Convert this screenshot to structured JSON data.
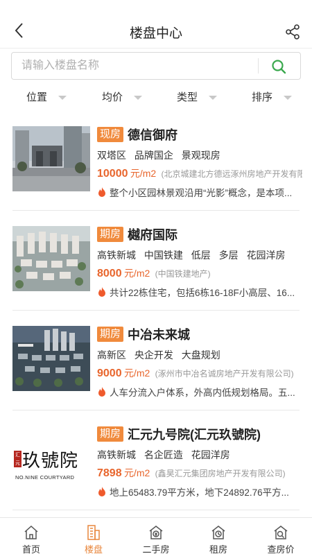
{
  "header": {
    "title": "楼盘中心"
  },
  "search": {
    "placeholder": "请输入楼盘名称"
  },
  "filters": [
    "位置",
    "均价",
    "类型",
    "排序"
  ],
  "listings": [
    {
      "badge": "现房",
      "name": "德信御府",
      "tags": [
        "双塔区",
        "品牌国企",
        "景观现房"
      ],
      "price": "10000",
      "unit": "元/m2",
      "developer": "(北京城建北方德远涿州房地产开发有限",
      "desc": "整个小区园林景观沿用“光影”概念，是本项..."
    },
    {
      "badge": "期房",
      "name": "樾府国际",
      "tags": [
        "高铁新城",
        "中国铁建",
        "低层",
        "多层",
        "花园洋房"
      ],
      "price": "8000",
      "unit": "元/m2",
      "developer": "(中国铁建地产)",
      "desc": "共计22栋住宅，包括6栋16-18F小高层、16..."
    },
    {
      "badge": "期房",
      "name": "中冶未来城",
      "tags": [
        "高新区",
        "央企开发",
        "大盘规划"
      ],
      "price": "9000",
      "unit": "元/m2",
      "developer": "(涿州市中冶名诚房地产开发有限公司)",
      "desc": "人车分流入户体系，外高内低规划格局。五..."
    },
    {
      "badge": "期房",
      "name": "汇元九号院(汇元玖號院)",
      "tags": [
        "高铁新城",
        "名企匠造",
        "花园洋房"
      ],
      "price": "7898",
      "unit": "元/m2",
      "developer": "(鑫昊汇元集团房地产开发有限公司)",
      "desc": "地上65483.79平方米，地下24892.76平方...",
      "logo": {
        "seal": "汇元",
        "text": "玖號院",
        "sub": "NO.NINE COURTYARD"
      }
    }
  ],
  "tabbar": [
    {
      "label": "首页",
      "icon": "home-icon",
      "active": false
    },
    {
      "label": "楼盘",
      "icon": "building-icon",
      "active": true
    },
    {
      "label": "二手房",
      "icon": "house-currency-icon",
      "active": false
    },
    {
      "label": "租房",
      "icon": "rent-house-icon",
      "active": false
    },
    {
      "label": "查房价",
      "icon": "price-search-icon",
      "active": false
    }
  ],
  "colors": {
    "accent": "#f08a3c",
    "price": "#e8652c",
    "search_icon": "#3aa84d"
  }
}
